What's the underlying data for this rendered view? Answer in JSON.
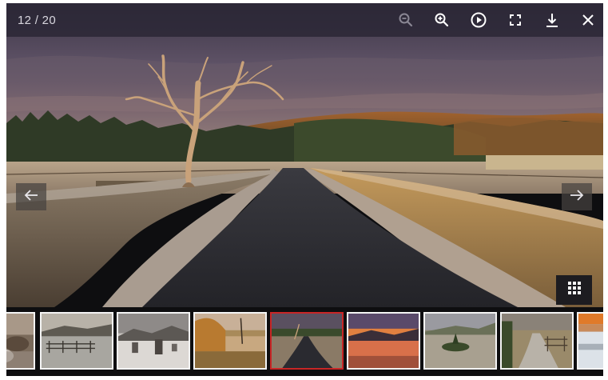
{
  "counter": {
    "current": "12",
    "total": "20",
    "text": "12 / 20"
  },
  "toolbar": {
    "buttons": [
      {
        "name": "zoom-out",
        "icon": "zoom-out-icon",
        "enabled": false
      },
      {
        "name": "zoom-in",
        "icon": "zoom-in-icon",
        "enabled": true
      },
      {
        "name": "slideshow",
        "icon": "play-icon",
        "enabled": true
      },
      {
        "name": "fullscreen",
        "icon": "fullscreen-icon",
        "enabled": true
      },
      {
        "name": "download",
        "icon": "download-icon",
        "enabled": true
      },
      {
        "name": "close",
        "icon": "close-icon",
        "enabled": true
      }
    ],
    "icon_color": "#ffffff",
    "disabled_icon_color": "#8a8794"
  },
  "navigation": {
    "prev_icon": "arrow-left-icon",
    "next_icon": "arrow-right-icon",
    "thumbnail_grid_icon": "grid-icon"
  },
  "image": {
    "subject": "country-road-at-sunset",
    "scene": [
      "bare-tree",
      "frosted-hedges",
      "asphalt-road",
      "forest-hill",
      "cloudy-purple-sky"
    ]
  },
  "thumbnails": {
    "active_index": 4,
    "active_border_color": "#c82626",
    "border_color": "#f4f4f4",
    "items": [
      {
        "icon": "thumbnail-frosty-rocks"
      },
      {
        "icon": "thumbnail-flooded-fence"
      },
      {
        "icon": "thumbnail-stone-circle"
      },
      {
        "icon": "thumbnail-autumn-lake"
      },
      {
        "icon": "thumbnail-country-road"
      },
      {
        "icon": "thumbnail-sunset-lake"
      },
      {
        "icon": "thumbnail-island-lake"
      },
      {
        "icon": "thumbnail-gated-path"
      },
      {
        "icon": "thumbnail-frozen-shore"
      }
    ]
  }
}
